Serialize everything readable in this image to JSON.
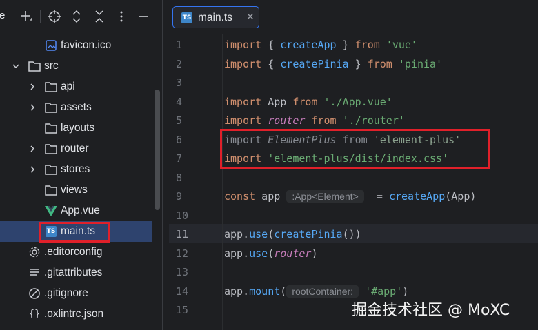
{
  "sidebar": {
    "title_fragment": "e",
    "toolbar_icons": [
      "plus-icon",
      "crosshair-icon",
      "expand-icon",
      "collapse-icon",
      "more-icon",
      "minimize-icon"
    ],
    "items": [
      {
        "label": "favicon.ico",
        "kind": "image-file",
        "indent": 2,
        "chevron": "none"
      },
      {
        "label": "src",
        "kind": "folder",
        "indent": 1,
        "chevron": "down"
      },
      {
        "label": "api",
        "kind": "folder",
        "indent": 2,
        "chevron": "right"
      },
      {
        "label": "assets",
        "kind": "folder",
        "indent": 2,
        "chevron": "right"
      },
      {
        "label": "layouts",
        "kind": "folder",
        "indent": 2,
        "chevron": "none"
      },
      {
        "label": "router",
        "kind": "folder",
        "indent": 2,
        "chevron": "right"
      },
      {
        "label": "stores",
        "kind": "folder",
        "indent": 2,
        "chevron": "right"
      },
      {
        "label": "views",
        "kind": "folder",
        "indent": 2,
        "chevron": "none"
      },
      {
        "label": "App.vue",
        "kind": "vue-file",
        "indent": 2,
        "chevron": "none"
      },
      {
        "label": "main.ts",
        "kind": "ts-file",
        "indent": 2,
        "chevron": "none",
        "selected": true
      },
      {
        "label": ".editorconfig",
        "kind": "gear-file",
        "indent": 1,
        "chevron": "none"
      },
      {
        "label": ".gitattributes",
        "kind": "lines-file",
        "indent": 1,
        "chevron": "none"
      },
      {
        "label": ".gitignore",
        "kind": "ignore-file",
        "indent": 1,
        "chevron": "none"
      },
      {
        "label": ".oxlintrc.json",
        "kind": "json-file",
        "indent": 1,
        "chevron": "none"
      }
    ]
  },
  "editor": {
    "tab": {
      "label": "main.ts",
      "badge": "TS",
      "close": "✕"
    },
    "active_line": "11",
    "lines": [
      {
        "n": "1",
        "tokens": [
          [
            "kw",
            "import"
          ],
          [
            "punc",
            " { "
          ],
          [
            "fn",
            "createApp"
          ],
          [
            "punc",
            " } "
          ],
          [
            "kw",
            "from"
          ],
          [
            "punc",
            " "
          ],
          [
            "str",
            "'vue'"
          ]
        ]
      },
      {
        "n": "2",
        "tokens": [
          [
            "kw",
            "import"
          ],
          [
            "punc",
            " { "
          ],
          [
            "fn",
            "createPinia"
          ],
          [
            "punc",
            " } "
          ],
          [
            "kw",
            "from"
          ],
          [
            "punc",
            " "
          ],
          [
            "str",
            "'pinia'"
          ]
        ]
      },
      {
        "n": "3",
        "tokens": []
      },
      {
        "n": "4",
        "tokens": [
          [
            "kw",
            "import"
          ],
          [
            "id",
            " App "
          ],
          [
            "kw",
            "from"
          ],
          [
            "punc",
            " "
          ],
          [
            "str",
            "'./App.vue'"
          ]
        ]
      },
      {
        "n": "5",
        "tokens": [
          [
            "kw",
            "import"
          ],
          [
            "punc",
            " "
          ],
          [
            "it",
            "router"
          ],
          [
            "punc",
            " "
          ],
          [
            "kw",
            "from"
          ],
          [
            "punc",
            " "
          ],
          [
            "str",
            "'./router'"
          ]
        ]
      },
      {
        "n": "6",
        "tokens": [
          [
            "grey",
            "import "
          ],
          [
            "greyit",
            "ElementPlus"
          ],
          [
            "grey",
            " from "
          ],
          [
            "greystr",
            "'element-plus'"
          ]
        ]
      },
      {
        "n": "7",
        "tokens": [
          [
            "kw",
            "import"
          ],
          [
            "punc",
            " "
          ],
          [
            "str",
            "'element-plus/dist/index.css'"
          ]
        ]
      },
      {
        "n": "8",
        "tokens": []
      },
      {
        "n": "9",
        "tokens": [
          [
            "kw",
            "const"
          ],
          [
            "id",
            " app "
          ],
          [
            "hint",
            ":App<Element>"
          ],
          [
            "punc",
            "  = "
          ],
          [
            "fn",
            "createApp"
          ],
          [
            "punc",
            "(App)"
          ]
        ]
      },
      {
        "n": "10",
        "tokens": []
      },
      {
        "n": "11",
        "tokens": [
          [
            "id",
            "app."
          ],
          [
            "method",
            "use"
          ],
          [
            "punc",
            "("
          ],
          [
            "fn",
            "createPinia"
          ],
          [
            "punc",
            "())"
          ]
        ]
      },
      {
        "n": "12",
        "tokens": [
          [
            "id",
            "app."
          ],
          [
            "method",
            "use"
          ],
          [
            "punc",
            "("
          ],
          [
            "it",
            "router"
          ],
          [
            "punc",
            ")"
          ]
        ]
      },
      {
        "n": "13",
        "tokens": []
      },
      {
        "n": "14",
        "tokens": [
          [
            "id",
            "app."
          ],
          [
            "method",
            "mount"
          ],
          [
            "punc",
            "("
          ],
          [
            "hint",
            "rootContainer:"
          ],
          [
            "punc",
            " "
          ],
          [
            "str",
            "'#app'"
          ],
          [
            "punc",
            ")"
          ]
        ]
      },
      {
        "n": "15",
        "tokens": []
      }
    ]
  },
  "watermark": "掘金技术社区 @ MoXC",
  "colors": {
    "highlight_box": "#e0202a",
    "selection": "#2e436e",
    "tab_border": "#3574f0"
  }
}
